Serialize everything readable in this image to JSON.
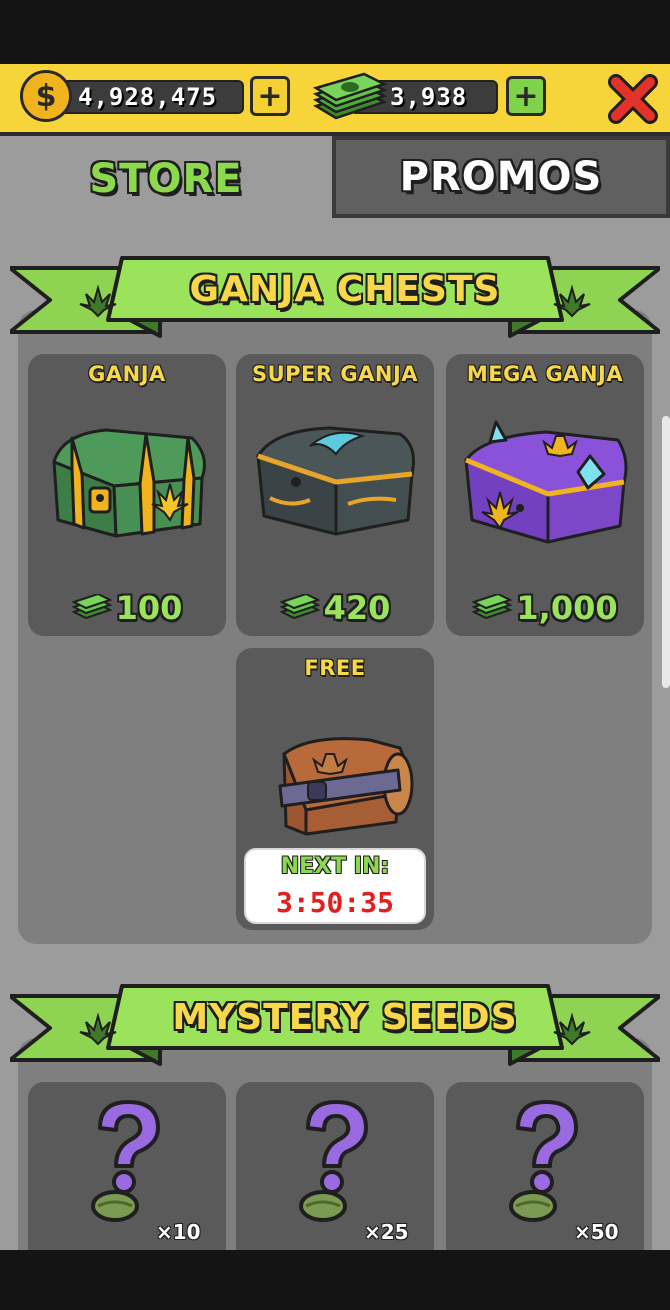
{
  "topbar": {
    "coins": "4,928,475",
    "cash": "3,938",
    "coin_symbol": "$",
    "plus_symbol": "+"
  },
  "tabs": {
    "store": "STORE",
    "promos": "PROMOS"
  },
  "chests": {
    "title": "GANJA CHESTS",
    "items": [
      {
        "name": "GANJA",
        "price": "100"
      },
      {
        "name": "SUPER GANJA",
        "price": "420"
      },
      {
        "name": "MEGA GANJA",
        "price": "1,000"
      }
    ],
    "free": {
      "name": "FREE",
      "next_label": "NEXT IN:",
      "timer": "3:50:35"
    }
  },
  "seeds": {
    "title": "MYSTERY SEEDS",
    "items": [
      {
        "multiplier": "×10"
      },
      {
        "multiplier": "×25"
      },
      {
        "multiplier": "×50"
      }
    ]
  },
  "colors": {
    "topbar": "#f6d43a",
    "accent_green": "#8cd94e",
    "title_yellow": "#f7d84a",
    "timer_red": "#e0201e",
    "card_bg": "#5a5a5a",
    "panel_bg": "#7f7f7f"
  },
  "icons": [
    "coin-icon",
    "cash-stack-icon",
    "close-x-icon",
    "leaf-icon",
    "question-mark-icon",
    "seed-icon",
    "chest-icon"
  ]
}
